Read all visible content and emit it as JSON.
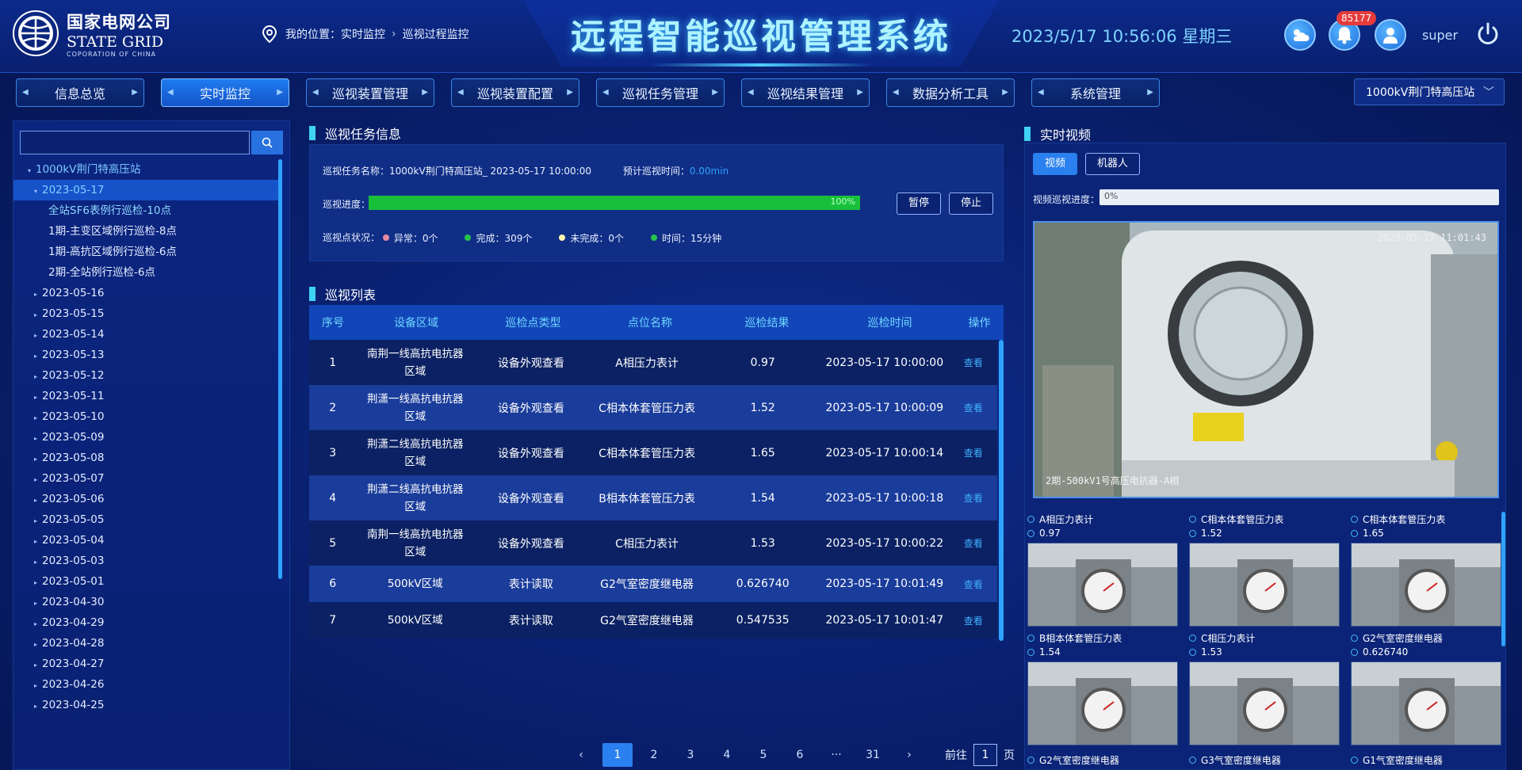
{
  "header": {
    "logo_cn": "国家电网公司",
    "logo_en": "STATE GRID",
    "logo_sub": "COPORATION OF CHINA",
    "location_label": "我的位置：实时监控",
    "location_current": "巡视过程监控",
    "system_title": "远程智能巡视管理系统",
    "datetime": "2023/5/17 10:56:06 星期三",
    "alarm_count": "85177",
    "user_name": "super"
  },
  "nav": {
    "items": [
      "信息总览",
      "实时监控",
      "巡视装置管理",
      "巡视装置配置",
      "巡视任务管理",
      "巡视结果管理",
      "数据分析工具",
      "系统管理"
    ],
    "active_index": 1,
    "station": "1000kV荆门特高压站"
  },
  "tree": {
    "root": "1000kV荆门特高压站",
    "open_date": "2023-05-17",
    "tasks": [
      "全站SF6表例行巡检-10点",
      "1期-主变区域例行巡检-8点",
      "1期-高抗区域例行巡检-6点",
      "2期-全站例行巡检-6点"
    ],
    "dates": [
      "2023-05-16",
      "2023-05-15",
      "2023-05-14",
      "2023-05-13",
      "2023-05-12",
      "2023-05-11",
      "2023-05-10",
      "2023-05-09",
      "2023-05-08",
      "2023-05-07",
      "2023-05-06",
      "2023-05-05",
      "2023-05-04",
      "2023-05-03",
      "2023-05-01",
      "2023-04-30",
      "2023-04-29",
      "2023-04-28",
      "2023-04-27",
      "2023-04-26",
      "2023-04-25"
    ]
  },
  "task_info": {
    "section_title": "巡视任务信息",
    "name_label": "巡视任务名称：",
    "name_value": "1000kV荆门特高压站_ 2023-05-17 10:00:00",
    "eta_label": "预计巡视时间：",
    "eta_value": "0.00min",
    "progress_label": "巡视进度：",
    "progress": 1.0,
    "progress_text": "100%",
    "pause_label": "暂停",
    "stop_label": "停止",
    "status_label": "巡视点状况：",
    "status": [
      {
        "text": "异常：0个",
        "color": "#e58aa0"
      },
      {
        "text": "完成：309个",
        "color": "#27c24c"
      },
      {
        "text": "未完成：0个",
        "color": "#fff5b0"
      },
      {
        "text": "时间：15分钟",
        "color": "#27c24c"
      }
    ]
  },
  "list": {
    "section_title": "巡视列表",
    "columns": [
      "序号",
      "设备区域",
      "巡检点类型",
      "点位名称",
      "巡检结果",
      "巡检时间",
      "操作"
    ],
    "rows": [
      {
        "no": "1",
        "area1": "南荆一线高抗电抗器",
        "area2": "区域",
        "type": "设备外观查看",
        "point": "A相压力表计",
        "result": "0.97",
        "time": "2023-05-17 10:00:00",
        "op": "查看"
      },
      {
        "no": "2",
        "area1": "荆潇一线高抗电抗器",
        "area2": "区域",
        "type": "设备外观查看",
        "point": "C相本体套管压力表",
        "result": "1.52",
        "time": "2023-05-17 10:00:09",
        "op": "查看"
      },
      {
        "no": "3",
        "area1": "荆潇二线高抗电抗器",
        "area2": "区域",
        "type": "设备外观查看",
        "point": "C相本体套管压力表",
        "result": "1.65",
        "time": "2023-05-17 10:00:14",
        "op": "查看"
      },
      {
        "no": "4",
        "area1": "荆潇二线高抗电抗器",
        "area2": "区域",
        "type": "设备外观查看",
        "point": "B相本体套管压力表",
        "result": "1.54",
        "time": "2023-05-17 10:00:18",
        "op": "查看"
      },
      {
        "no": "5",
        "area1": "南荆一线高抗电抗器",
        "area2": "区域",
        "type": "设备外观查看",
        "point": "C相压力表计",
        "result": "1.53",
        "time": "2023-05-17 10:00:22",
        "op": "查看"
      },
      {
        "no": "6",
        "area1": "500kV区域",
        "area2": "",
        "type": "表计读取",
        "point": "G2气室密度继电器",
        "result": "0.626740",
        "time": "2023-05-17 10:01:49",
        "op": "查看"
      },
      {
        "no": "7",
        "area1": "500kV区域",
        "area2": "",
        "type": "表计读取",
        "point": "G2气室密度继电器",
        "result": "0.547535",
        "time": "2023-05-17 10:01:47",
        "op": "查看"
      }
    ]
  },
  "pager": {
    "prev": "‹",
    "next": "›",
    "pages": [
      "1",
      "2",
      "3",
      "4",
      "5",
      "6",
      "···",
      "31"
    ],
    "goto_label": "前往",
    "goto_value": "1",
    "page_unit": "页"
  },
  "video": {
    "section_title": "实时视频",
    "tab_video": "视频",
    "tab_robot": "机器人",
    "progress_label": "视频巡视进度：",
    "progress_text": "0%",
    "timestamp": "2023-05-17 11:01:43",
    "caption": "2期-500kV1号高压电抗器-A相"
  },
  "thumbs": [
    {
      "name": "A相压力表计",
      "value": "0.97"
    },
    {
      "name": "C相本体套管压力表",
      "value": "1.52"
    },
    {
      "name": "C相本体套管压力表",
      "value": "1.65"
    },
    {
      "name": "B相本体套管压力表",
      "value": "1.54"
    },
    {
      "name": "C相压力表计",
      "value": "1.53"
    },
    {
      "name": "G2气室密度继电器",
      "value": "0.626740"
    },
    {
      "name": "G2气室密度继电器",
      "value": ""
    },
    {
      "name": "G3气室密度继电器",
      "value": ""
    },
    {
      "name": "G1气室密度继电器",
      "value": ""
    }
  ]
}
